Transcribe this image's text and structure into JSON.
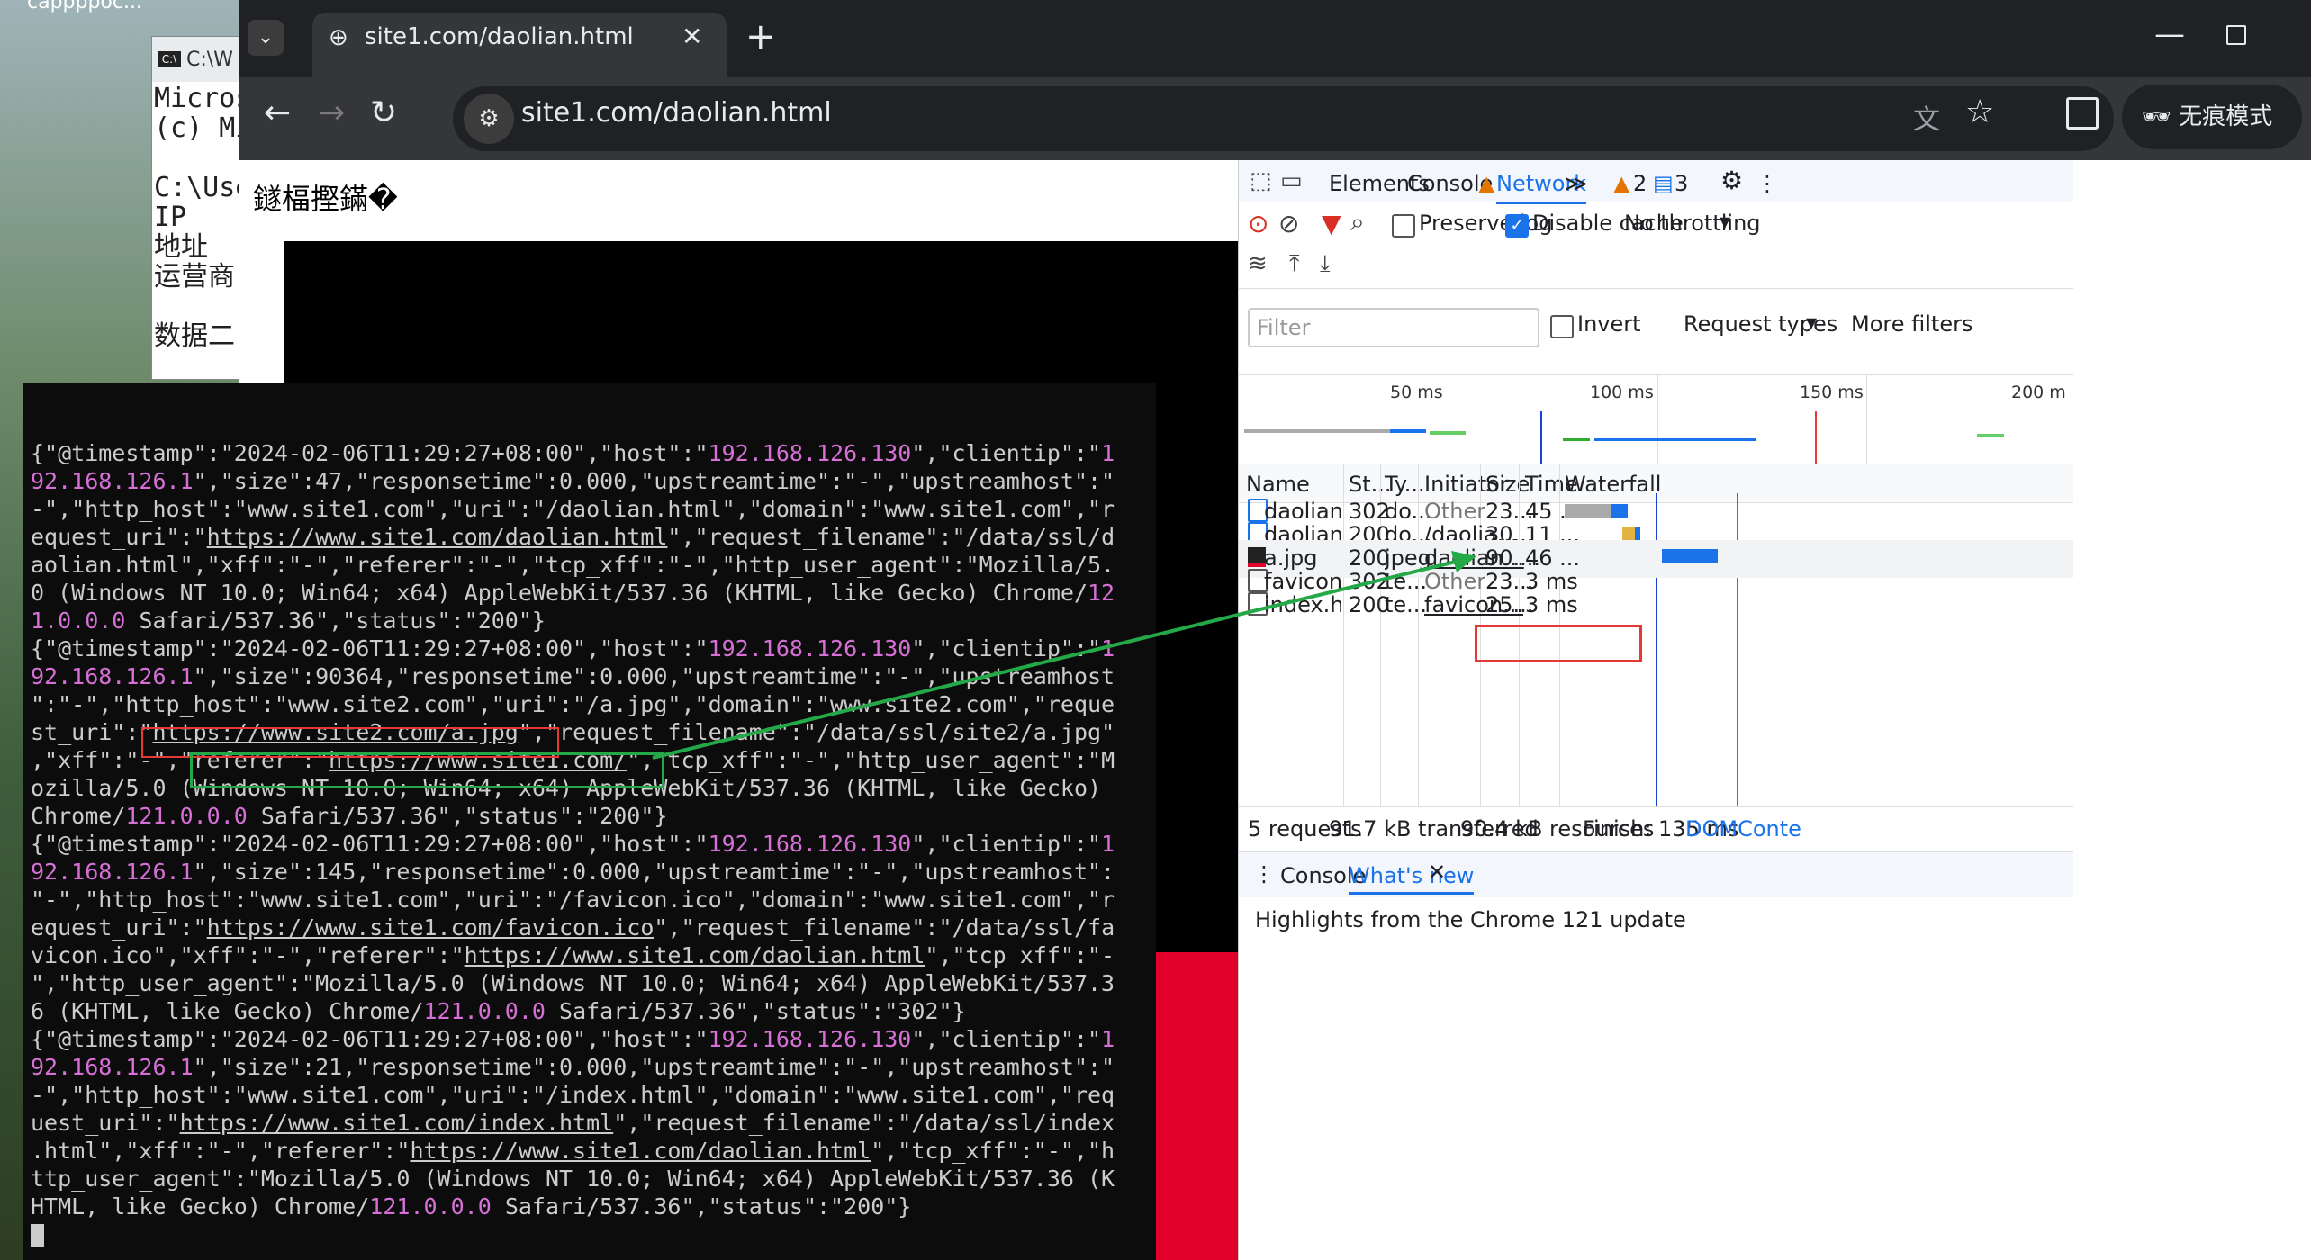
{
  "desktop": {
    "label": "cappppoc..."
  },
  "cmd_window": {
    "title": "C:\\W",
    "lines": [
      "Micros",
      "(c) Mi",
      "",
      "C:\\Use",
      "IP",
      "地址",
      "运营商",
      "",
      "数据二"
    ]
  },
  "browser": {
    "tab_title": "site1.com/daolian.html",
    "url": "site1.com/daolian.html",
    "incognito_label": "无痕模式"
  },
  "page": {
    "garbled_title": "鐩楅摼鏋�"
  },
  "devtools": {
    "tabs": [
      "Elements",
      "Console",
      "Network"
    ],
    "active_tab": "Network",
    "warnings_count": "2",
    "messages_count": "3",
    "preserve_log": "Preserve log",
    "disable_cache": "Disable cache",
    "throttling": "No throttling",
    "filter_placeholder": "Filter",
    "invert": "Invert",
    "request_types": "Request types",
    "more_filters": "More filters",
    "timeline_labels": [
      "50 ms",
      "100 ms",
      "150 ms",
      "200 m"
    ],
    "columns": [
      "Name",
      "St...",
      "Ty...",
      "Initiator",
      "Size",
      "Time",
      "Waterfall"
    ],
    "requests": [
      {
        "name": "daolian.html",
        "status": "302",
        "type": "do...",
        "initiator": "Other",
        "size": "23...",
        "time": "45 ..."
      },
      {
        "name": "daolian.html",
        "status": "200",
        "type": "do...",
        "initiator": "/daolia...",
        "size": "30...",
        "time": "11 ..."
      },
      {
        "name": "a.jpg",
        "status": "200",
        "type": "jpeg",
        "initiator": "daolian...",
        "size": "90....",
        "time": "46 ..."
      },
      {
        "name": "favicon.ico",
        "status": "302",
        "type": "te...",
        "initiator": "Other",
        "size": "23...",
        "time": "3 ms"
      },
      {
        "name": "index.html",
        "status": "200",
        "type": "te...",
        "initiator": "favicon...",
        "size": "25...",
        "time": "3 ms"
      }
    ],
    "summary": {
      "requests": "5 requests",
      "transferred": "91.7 kB transferred",
      "resources": "90.4 kB resources",
      "finish": "Finish: 135 ms",
      "domcontent": "DOMConte"
    },
    "drawer_tabs": [
      "Console",
      "What's new"
    ],
    "drawer_text": "Highlights from the Chrome 121 update"
  },
  "terminal": {
    "ghost_text": "ights from the Chrome 121 update"
  },
  "colors": {
    "terminal_bg": "#0c0c0c",
    "terminal_fg": "#cccccc",
    "terminal_ip": "#d670d6",
    "annotation_red": "#e53935",
    "annotation_green": "#24a848",
    "devtools_accent": "#1a73e8"
  }
}
